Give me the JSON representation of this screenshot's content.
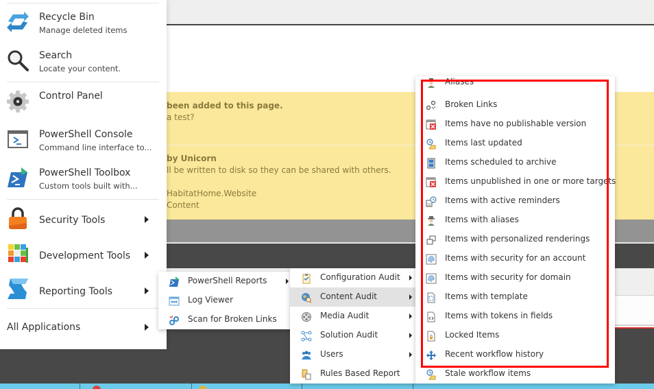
{
  "background": {
    "notice1": {
      "line1": "been added to this page.",
      "line2": "a test?"
    },
    "notice2": {
      "line1": "by Unicorn",
      "line2": "ll be written to disk so they can be shared with others.",
      "line3": "HabitatHome.Website",
      "line4": "Content"
    }
  },
  "start_menu": {
    "items": [
      {
        "title": "Recycle Bin",
        "subtitle": "Manage deleted items",
        "icon": "recycle-bin-icon"
      },
      {
        "title": "Search",
        "subtitle": "Locate your content.",
        "icon": "search-icon"
      },
      {
        "title": "Control Panel",
        "subtitle": "",
        "icon": "gear-icon"
      },
      {
        "title": "PowerShell Console",
        "subtitle": "Command line interface to...",
        "icon": "powershell-console-icon"
      },
      {
        "title": "PowerShell Toolbox",
        "subtitle": "Custom tools built with...",
        "icon": "powershell-toolbox-icon"
      },
      {
        "title": "Security Tools",
        "subtitle": "",
        "icon": "lock-icon",
        "has_submenu": true
      },
      {
        "title": "Development Tools",
        "subtitle": "",
        "icon": "rubiks-cube-icon",
        "has_submenu": true
      },
      {
        "title": "Reporting Tools",
        "subtitle": "",
        "icon": "reporting-icon",
        "has_submenu": true
      }
    ],
    "all_applications": "All Applications"
  },
  "reporting_menu": {
    "items": [
      {
        "label": "PowerShell Reports",
        "icon": "powershell-reports-icon",
        "has_submenu": true
      },
      {
        "label": "Log Viewer",
        "icon": "log-viewer-icon"
      },
      {
        "label": "Scan for Broken Links",
        "icon": "broken-links-scan-icon"
      }
    ]
  },
  "powershell_reports_menu": {
    "items": [
      {
        "label": "Configuration Audit",
        "icon": "clipboard-check-icon",
        "has_submenu": true
      },
      {
        "label": "Content Audit",
        "icon": "globe-search-icon",
        "has_submenu": true,
        "highlighted": true
      },
      {
        "label": "Media Audit",
        "icon": "film-reel-icon",
        "has_submenu": true
      },
      {
        "label": "Solution Audit",
        "icon": "network-nodes-icon",
        "has_submenu": true
      },
      {
        "label": "Users",
        "icon": "users-group-icon",
        "has_submenu": true
      },
      {
        "label": "Rules Based Report",
        "icon": "rules-report-icon"
      }
    ]
  },
  "content_audit_menu": {
    "items": [
      {
        "label": "Aliases",
        "icon": "alias-person-icon"
      },
      {
        "label": "Broken Links",
        "icon": "broken-link-icon"
      },
      {
        "label": "Items have no publishable version",
        "icon": "unpublishable-icon"
      },
      {
        "label": "Items last updated",
        "icon": "clock-scroll-icon"
      },
      {
        "label": "Items scheduled to archive",
        "icon": "archive-cabinet-icon"
      },
      {
        "label": "Items unpublished in one or more targets",
        "icon": "unpublished-icon"
      },
      {
        "label": "Items with active reminders",
        "icon": "calendar-clock-icon"
      },
      {
        "label": "Items with aliases",
        "icon": "alias-person-icon"
      },
      {
        "label": "Items with personalized renderings",
        "icon": "personalized-rendering-icon"
      },
      {
        "label": "Items with security for an account",
        "icon": "fingerprint-icon"
      },
      {
        "label": "Items with security for domain",
        "icon": "fingerprint-icon"
      },
      {
        "label": "Items with template",
        "icon": "template-document-icon"
      },
      {
        "label": "Items with tokens in fields",
        "icon": "code-document-icon"
      },
      {
        "label": "Locked Items",
        "icon": "locked-document-icon"
      },
      {
        "label": "Recent workflow history",
        "icon": "workflow-arrows-icon"
      },
      {
        "label": "Stale workflow items",
        "icon": "clock-scroll-icon"
      }
    ],
    "highlight_box_color": "#ff0000"
  }
}
